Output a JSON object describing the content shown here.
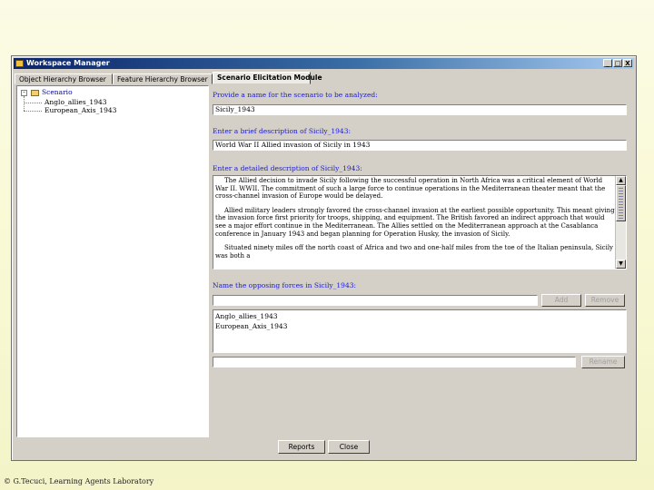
{
  "window": {
    "title": "Workspace Manager",
    "controls": [
      "_",
      "□",
      "X"
    ]
  },
  "tabs": [
    {
      "label": "Object Hierarchy Browser",
      "active": false
    },
    {
      "label": "Feature Hierarchy Browser",
      "active": false
    },
    {
      "label": "Scenario Elicitation Module",
      "active": true
    }
  ],
  "tree": {
    "root": {
      "expander": "-",
      "label": "Scenario"
    },
    "children": [
      "Anglo_allies_1943",
      "European_Axis_1943"
    ]
  },
  "form": {
    "name_label": "Provide a name for the scenario to be analyzed:",
    "name_value": "Sicily_1943",
    "brief_label": "Enter a brief description of Sicily_1943:",
    "brief_value": "World War II Allied invasion of Sicily in 1943",
    "detailed_label": "Enter a detailed description of Sicily_1943:",
    "detailed_paragraphs": [
      "The Allied decision to invade Sicily following the successful operation in North Africa was a critical element of World War II. WWII. The commitment of such a large force to continue operations in the Mediterranean theater meant that the cross-channel invasion of Europe would be delayed.",
      "Allied military leaders strongly favored the cross-channel invasion at the earliest possible opportunity. This meant giving the invasion force first priority for troops, shipping, and equipment. The British favored an indirect approach that would see a major effort continue in the Mediterranean. The Allies settled on the Mediterranean approach at the Casablanca conference in January 1943 and began planning for Operation Husky, the invasion of Sicily.",
      "Situated ninety miles off the north coast of Africa and two and one-half miles from the toe of the Italian peninsula, Sicily was both a"
    ],
    "forces_label": "Name the opposing forces in Sicily_1943:",
    "forces_input_value": "",
    "add_button": "Add",
    "remove_button_top": "Remove",
    "forces_list": [
      "Anglo_allies_1943",
      "European_Axis_1943"
    ],
    "second_input_value": "",
    "remove_button_bottom": "Rename"
  },
  "buttons": {
    "reports": "Reports",
    "close": "Close"
  },
  "footer": "© G.Tecuci, Learning Agents Laboratory"
}
